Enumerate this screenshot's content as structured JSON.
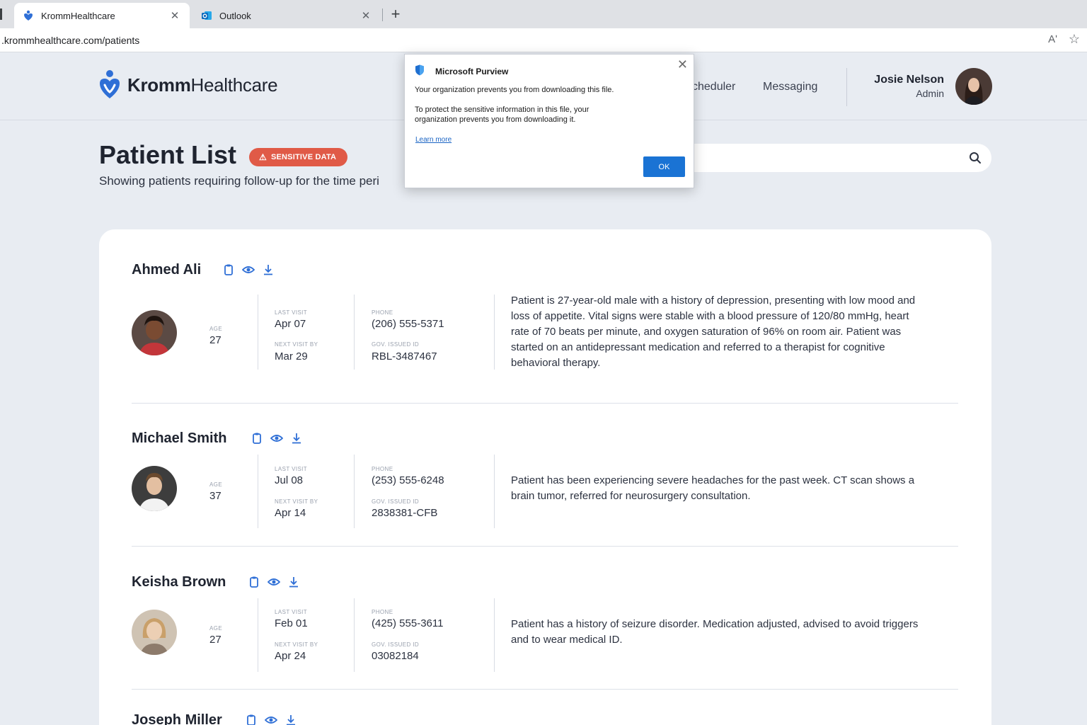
{
  "browser": {
    "tabs": [
      {
        "title": "KrommHealthcare",
        "close": "✕",
        "active": true
      },
      {
        "title": "Outlook",
        "close": "✕",
        "active": false
      }
    ],
    "new_tab": "+",
    "url": ".krommhealthcare.com/patients",
    "read_aloud_icon": "Aʹ",
    "favorite_icon": "☆"
  },
  "header": {
    "logo_bold": "Kromm",
    "logo_light": "Healthcare",
    "nav": {
      "scheduler": "cheduler",
      "messaging": "Messaging"
    },
    "user": {
      "name": "Josie Nelson",
      "role": "Admin"
    }
  },
  "page": {
    "title": "Patient List",
    "badge": {
      "icon": "⚠",
      "label": "SENSITIVE DATA"
    },
    "subtitle": "Showing patients requiring follow-up for the time peri"
  },
  "labels": {
    "age": "AGE",
    "last_visit": "LAST VISIT",
    "next_visit": "NEXT VISIT BY",
    "phone": "PHONE",
    "gov_id": "GOV. ISSUED ID"
  },
  "patients": [
    {
      "name": "Ahmed Ali",
      "age": "27",
      "last_visit": "Apr 07",
      "next_visit": "Mar 29",
      "phone": "(206) 555-5371",
      "gov_id": "RBL-3487467",
      "note": "Patient is 27-year-old male with a history of depression, presenting with low mood and loss of appetite. Vital signs were stable with a blood pressure of 120/80 mmHg, heart rate of 70 beats per minute, and oxygen saturation of 96% on room air. Patient was started on an antidepressant medication and referred to a therapist for cognitive behavioral therapy."
    },
    {
      "name": "Michael Smith",
      "age": "37",
      "last_visit": "Jul 08",
      "next_visit": "Apr 14",
      "phone": "(253) 555-6248",
      "gov_id": "2838381-CFB",
      "note": "Patient has been experiencing severe headaches for the past week. CT scan shows a brain tumor, referred for neurosurgery consultation."
    },
    {
      "name": "Keisha Brown",
      "age": "27",
      "last_visit": "Feb 01",
      "next_visit": "Apr 24",
      "phone": "(425) 555-3611",
      "gov_id": "03082184",
      "note": "Patient has a history of seizure disorder. Medication adjusted, advised to avoid triggers and to wear medical ID."
    },
    {
      "name": "Joseph Miller"
    }
  ],
  "dialog": {
    "title": "Microsoft Purview",
    "message1": "Your organization prevents you from downloading this file.",
    "message2": "To protect the sensitive information in this file, your organization prevents you from downloading it.",
    "link": "Learn more",
    "ok": "OK",
    "close": "✕"
  },
  "colors": {
    "accent": "#2f6fd6",
    "badge": "#e05a47",
    "ok_button": "#1a73d4",
    "page_bg": "#e8ecf2"
  }
}
